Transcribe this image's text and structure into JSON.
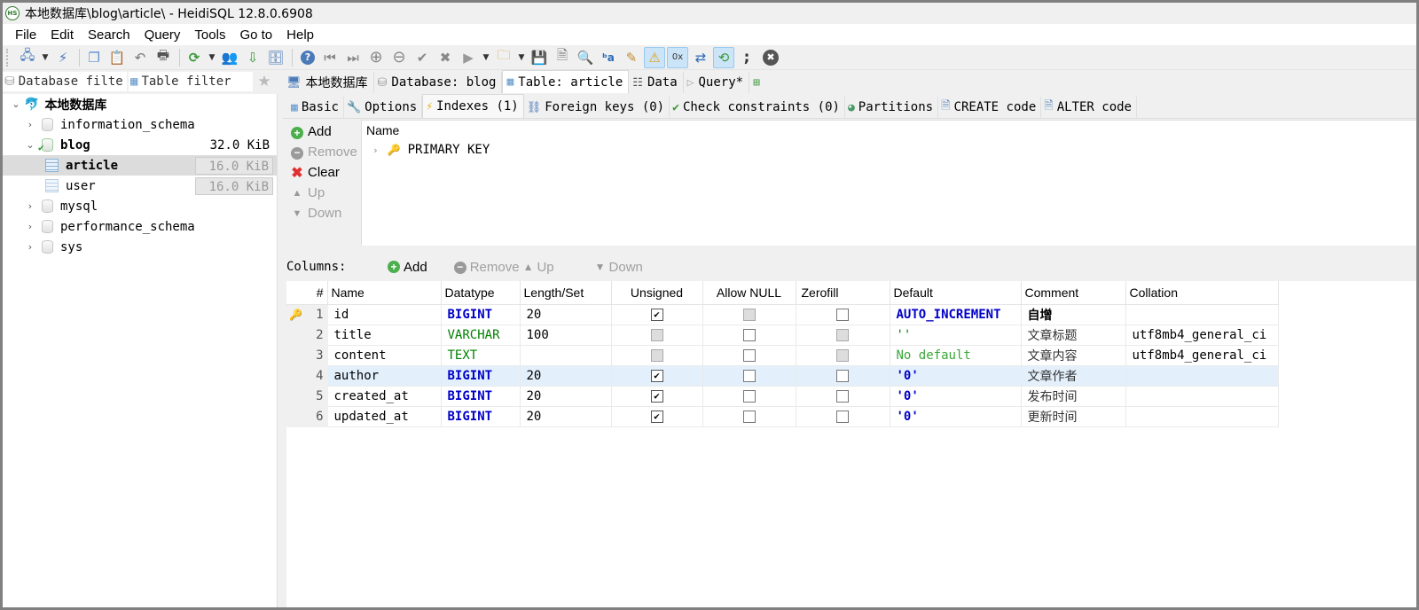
{
  "window": {
    "app_icon": "HS",
    "title": "本地数据库\\blog\\article\\ - HeidiSQL 12.8.0.6908"
  },
  "menu": [
    "File",
    "Edit",
    "Search",
    "Query",
    "Tools",
    "Go to",
    "Help"
  ],
  "toolbar": {
    "buttons": [
      {
        "name": "connect-icon",
        "glyph": "🖧"
      },
      {
        "name": "disconnect-icon",
        "glyph": "⚡"
      },
      {
        "name": "copy-icon",
        "glyph": "❐"
      },
      {
        "name": "paste-icon",
        "glyph": "📋"
      },
      {
        "name": "undo-icon",
        "glyph": "↶"
      },
      {
        "name": "print-icon",
        "glyph": "🖶"
      },
      {
        "name": "refresh-icon",
        "glyph": "⟳"
      },
      {
        "name": "user-manager-icon",
        "glyph": "👥"
      },
      {
        "name": "import-icon",
        "glyph": "⇩"
      },
      {
        "name": "export-icon",
        "glyph": "🗄"
      },
      {
        "name": "help-icon",
        "glyph": "?"
      },
      {
        "name": "first-icon",
        "glyph": "⏮"
      },
      {
        "name": "last-icon",
        "glyph": "⏭"
      },
      {
        "name": "insert-row-icon",
        "glyph": "⊕"
      },
      {
        "name": "delete-row-icon",
        "glyph": "⊖"
      },
      {
        "name": "post-icon",
        "glyph": "✔"
      },
      {
        "name": "cancel-icon",
        "glyph": "✖"
      },
      {
        "name": "run-icon",
        "glyph": "▶"
      },
      {
        "name": "load-sql-icon",
        "glyph": "🗀"
      },
      {
        "name": "save-icon",
        "glyph": "💾"
      },
      {
        "name": "save-as-icon",
        "glyph": "🗎"
      },
      {
        "name": "find-icon",
        "glyph": "🔍"
      },
      {
        "name": "replace-icon",
        "glyph": "ᵇa"
      },
      {
        "name": "format-icon",
        "glyph": "✎"
      },
      {
        "name": "stop-on-error-icon",
        "glyph": "⚠"
      },
      {
        "name": "hex-blob-icon",
        "glyph": "0x"
      },
      {
        "name": "wrap-icon",
        "glyph": "⇄"
      },
      {
        "name": "auto-commit-icon",
        "glyph": "⟲"
      },
      {
        "name": "delimiter-icon",
        "glyph": ";"
      },
      {
        "name": "close-icon",
        "glyph": "✖"
      }
    ]
  },
  "filters": {
    "database_filter": "Database filte",
    "table_filter": "Table filter"
  },
  "main_tabs": [
    {
      "label": "本地数据库",
      "icon": "server-icon",
      "glyph": "🖥"
    },
    {
      "label": "Database: blog",
      "icon": "database-icon",
      "glyph": "⛁"
    },
    {
      "label": "Table: article",
      "icon": "table-icon",
      "glyph": "▦",
      "active": true
    },
    {
      "label": "Data",
      "icon": "data-icon",
      "glyph": "☷"
    },
    {
      "label": "Query*",
      "icon": "query-icon",
      "glyph": "▷"
    },
    {
      "label": "",
      "icon": "new-query-tab-icon",
      "glyph": "⊞"
    }
  ],
  "tree": {
    "root": "本地数据库",
    "nodes": [
      {
        "label": "information_schema",
        "level": 1,
        "expander": ">",
        "size": ""
      },
      {
        "label": "blog",
        "level": 1,
        "expander": "v",
        "size": "32.0 KiB",
        "bold": true
      },
      {
        "label": "article",
        "level": 2,
        "size": "16.0 KiB",
        "selected": true,
        "bold": true
      },
      {
        "label": "user",
        "level": 2,
        "size": "16.0 KiB"
      },
      {
        "label": "mysql",
        "level": 1,
        "expander": ">",
        "size": ""
      },
      {
        "label": "performance_schema",
        "level": 1,
        "expander": ">",
        "size": ""
      },
      {
        "label": "sys",
        "level": 1,
        "expander": ">",
        "size": ""
      }
    ]
  },
  "sub_tabs": [
    {
      "label": "Basic",
      "glyph": "▦",
      "icon": "basic-icon"
    },
    {
      "label": "Options",
      "glyph": "🔧",
      "icon": "wrench-icon"
    },
    {
      "label": "Indexes (1)",
      "glyph": "⚡",
      "icon": "lightning-icon",
      "active": true
    },
    {
      "label": "Foreign keys (0)",
      "glyph": "⛓",
      "icon": "foreign-key-icon"
    },
    {
      "label": "Check constraints (0)",
      "glyph": "✔",
      "icon": "check-icon"
    },
    {
      "label": "Partitions",
      "glyph": "◕",
      "icon": "pie-icon"
    },
    {
      "label": "CREATE code",
      "glyph": "🗎",
      "icon": "script-icon"
    },
    {
      "label": "ALTER code",
      "glyph": "🗎",
      "icon": "script-icon"
    }
  ],
  "index_buttons": {
    "add": "Add",
    "remove": "Remove",
    "clear": "Clear",
    "up": "Up",
    "down": "Down"
  },
  "index_tree": {
    "header": "Name",
    "items": [
      {
        "label": "PRIMARY KEY"
      }
    ]
  },
  "columns_bar": {
    "label": "Columns:",
    "add": "Add",
    "remove": "Remove",
    "up": "Up",
    "down": "Down"
  },
  "columns_grid": {
    "headers": [
      "#",
      "Name",
      "Datatype",
      "Length/Set",
      "Unsigned",
      "Allow NULL",
      "Zerofill",
      "Default",
      "Comment",
      "Collation"
    ],
    "rows": [
      {
        "num": "1",
        "key": true,
        "name": "id",
        "datatype": "BIGINT",
        "type_color": "blue",
        "length": "20",
        "unsigned": "checked",
        "allow_null": "disabled",
        "zerofill": "empty",
        "default": "AUTO_INCREMENT",
        "default_style": "blue",
        "comment": "自增",
        "comment_bold": true,
        "collation": ""
      },
      {
        "num": "2",
        "name": "title",
        "datatype": "VARCHAR",
        "type_color": "green",
        "length": "100",
        "unsigned": "disabled",
        "allow_null": "empty",
        "zerofill": "disabled",
        "default": "''",
        "default_style": "green",
        "comment": "文章标题",
        "collation": "utf8mb4_general_ci"
      },
      {
        "num": "3",
        "name": "content",
        "datatype": "TEXT",
        "type_color": "green",
        "length": "",
        "unsigned": "disabled",
        "allow_null": "empty",
        "zerofill": "disabled",
        "default": "No default",
        "default_style": "lgreen",
        "comment": "文章内容",
        "collation": "utf8mb4_general_ci"
      },
      {
        "num": "4",
        "name": "author",
        "datatype": "BIGINT",
        "type_color": "blue",
        "length": "20",
        "unsigned": "checked",
        "allow_null": "empty",
        "zerofill": "empty",
        "default": "'0'",
        "default_style": "blue",
        "comment": "文章作者",
        "collation": "",
        "highlight": true
      },
      {
        "num": "5",
        "name": "created_at",
        "datatype": "BIGINT",
        "type_color": "blue",
        "length": "20",
        "unsigned": "checked",
        "allow_null": "empty",
        "zerofill": "empty",
        "default": "'0'",
        "default_style": "blue",
        "comment": "发布时间",
        "collation": ""
      },
      {
        "num": "6",
        "name": "updated_at",
        "datatype": "BIGINT",
        "type_color": "blue",
        "length": "20",
        "unsigned": "checked",
        "allow_null": "empty",
        "zerofill": "empty",
        "default": "'0'",
        "default_style": "blue",
        "comment": "更新时间",
        "collation": ""
      }
    ]
  },
  "colors": {
    "type_blue": "#0000c8",
    "type_green": "#008000",
    "default_lgreen": "#3aa73a",
    "row_highlight": "#e3f0fc",
    "selection_grey": "#dcdcdc"
  }
}
